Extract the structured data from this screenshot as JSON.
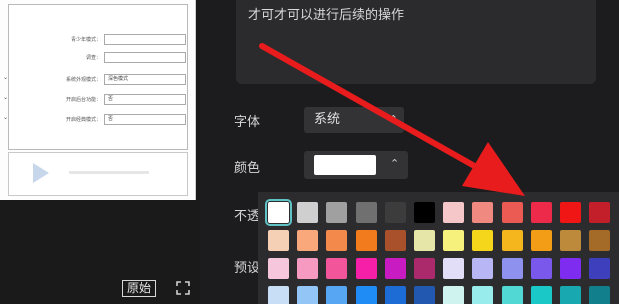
{
  "preview": {
    "form_rows": [
      {
        "label": "青少年模式：",
        "value": ""
      },
      {
        "label": "调查：",
        "value": ""
      },
      {
        "label": "系统外观模式：",
        "value": "深色模式"
      },
      {
        "label": "开启后台功能：",
        "value": "否"
      },
      {
        "label": "开启经典模式：",
        "value": "否"
      }
    ],
    "original_button": "原始",
    "icons": {
      "expand": "expand-icon"
    }
  },
  "panel": {
    "text_content": "才可才可以进行后续的操作",
    "font_label": "字体",
    "font_value": "系统",
    "color_label": "颜色",
    "color_value": "#ffffff",
    "partial_label_1": "不透",
    "partial_label_2": "预设"
  },
  "palette": {
    "rows": [
      [
        "#ffffff",
        "#cfcfcf",
        "#a0a0a0",
        "#707070",
        "#3c3c3c",
        "#000000",
        "#f6c7c9",
        "#f0897f",
        "#ec5a54",
        "#ee2a4b",
        "#f01616",
        "#c21f2b"
      ],
      [
        "#f6d0b4",
        "#f8a87a",
        "#f38a4c",
        "#f27b1d",
        "#a8512b",
        "#e6e6a8",
        "#f6f07c",
        "#f6d61b",
        "#f4b51d",
        "#f39d16",
        "#bd8a3c",
        "#a36a28"
      ],
      [
        "#f6c7dc",
        "#f69ac2",
        "#f2559a",
        "#f61fa8",
        "#c81bc2",
        "#aa2a6b",
        "#e2def8",
        "#b8b6f4",
        "#8e92ee",
        "#7a58ec",
        "#7e2cf0",
        "#3d3fbd"
      ],
      [
        "#c7def6",
        "#93c6f6",
        "#56a6f4",
        "#1e8cf4",
        "#1d6bd4",
        "#2258b0",
        "#cff4f0",
        "#98ecec",
        "#51d8d4",
        "#1ac8c8",
        "#17a8b0",
        "#12808c"
      ]
    ],
    "selected": "#ffffff"
  },
  "annotation": {
    "color": "#e81c1c"
  }
}
